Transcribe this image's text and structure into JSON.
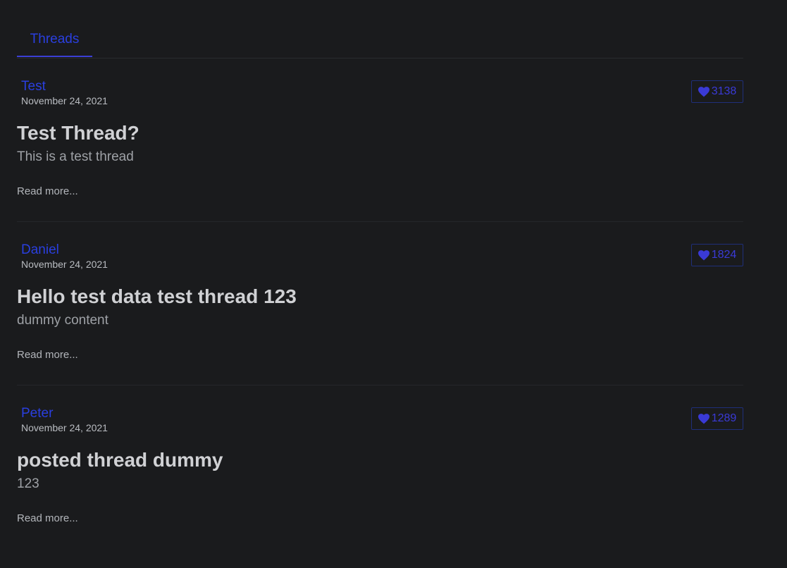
{
  "tabs": [
    {
      "label": "Threads"
    }
  ],
  "colors": {
    "background": "#1a1b1d",
    "accent": "#2a3fe0",
    "heart": "#3a3ad6"
  },
  "threads": [
    {
      "author": "Test",
      "date": "November 24, 2021",
      "likes": "3138",
      "title": "Test Thread?",
      "body": "This is a test thread",
      "read_more": "Read more..."
    },
    {
      "author": "Daniel",
      "date": "November 24, 2021",
      "likes": "1824",
      "title": "Hello test data test thread 123",
      "body": "dummy content",
      "read_more": "Read more..."
    },
    {
      "author": "Peter",
      "date": "November 24, 2021",
      "likes": "1289",
      "title": "posted thread dummy",
      "body": "123",
      "read_more": "Read more..."
    }
  ],
  "icons": {
    "like": "heart-icon"
  }
}
